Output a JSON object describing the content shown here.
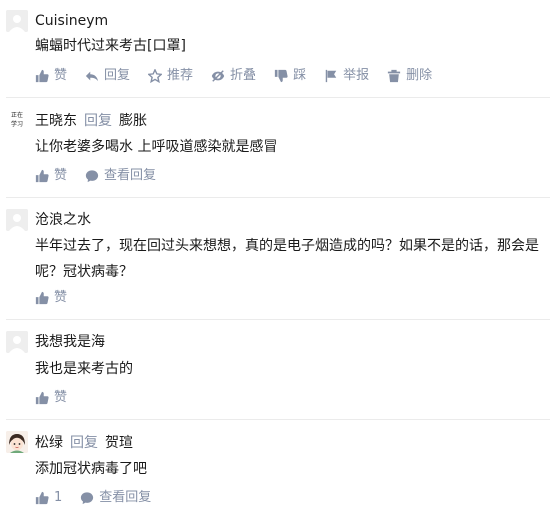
{
  "comments": [
    {
      "author": "Cuisineym",
      "content": "蝙蝠时代过来考古[口罩]",
      "actions": {
        "like": "赞",
        "reply": "回复",
        "recommend": "推荐",
        "collapse": "折叠",
        "dislike": "踩",
        "report": "举报",
        "delete": "删除"
      }
    },
    {
      "author": "王晓东",
      "reply_word": "回复",
      "reply_to": "膨胀",
      "avatar_text": [
        "正在",
        "学习"
      ],
      "content": "让你老婆多喝水 上呼吸道感染就是感冒",
      "actions": {
        "like": "赞",
        "view_replies": "查看回复"
      }
    },
    {
      "author": "沧浪之水",
      "content_line1": "半年过去了，现在回过头来想想，真的是电子烟造成的吗？如果不是的话，那会是",
      "content_line2": "呢？冠状病毒？",
      "actions": {
        "like": "赞"
      }
    },
    {
      "author": "我想我是海",
      "content": "我也是来考古的",
      "actions": {
        "like": "赞"
      }
    },
    {
      "author": "松绿",
      "reply_word": "回复",
      "reply_to": "贺瑄",
      "content": "添加冠状病毒了吧",
      "actions": {
        "like_count": "1",
        "view_replies": "查看回复"
      }
    }
  ],
  "colors": {
    "meta": "#8590a6",
    "text": "#1a1a1a",
    "divider": "#ebebeb"
  },
  "icons": [
    "thumb-up-icon",
    "reply-arrow-icon",
    "star-icon",
    "collapse-icon",
    "thumb-down-icon",
    "flag-icon",
    "trash-icon",
    "speech-bubble-icon"
  ]
}
